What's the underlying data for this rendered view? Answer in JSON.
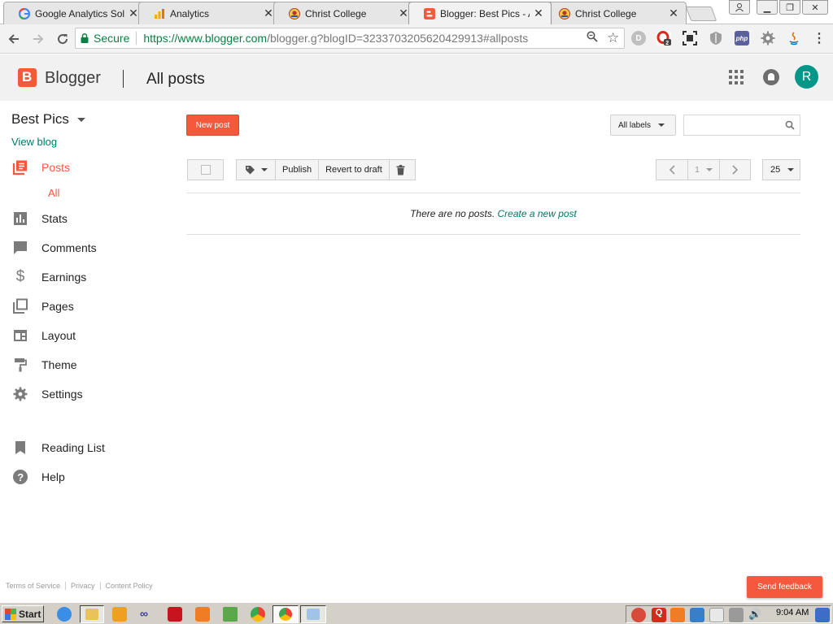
{
  "browser": {
    "tabs": [
      {
        "title": "Google Analytics Soluti",
        "icon": "google-g-icon"
      },
      {
        "title": "Analytics",
        "icon": "analytics-bars-icon"
      },
      {
        "title": "Christ College",
        "icon": "christ-college-icon"
      },
      {
        "title": "Blogger: Best Pics - All",
        "icon": "blogger-icon"
      },
      {
        "title": "Christ College",
        "icon": "christ-college-icon"
      }
    ],
    "secure_label": "Secure",
    "url_scheme_host": "https://www.blogger.com",
    "url_path": "/blogger.g?blogID=3233703205620429913#allposts",
    "ext_badge_count": "2"
  },
  "header": {
    "brand": "Blogger",
    "page_title": "All posts",
    "avatar_letter": "R"
  },
  "sidebar": {
    "blog_name": "Best Pics",
    "view_blog": "View blog",
    "items": [
      {
        "label": "Posts",
        "icon": "posts-icon"
      },
      {
        "label": "Stats",
        "icon": "stats-icon"
      },
      {
        "label": "Comments",
        "icon": "comments-icon"
      },
      {
        "label": "Earnings",
        "icon": "dollar-icon"
      },
      {
        "label": "Pages",
        "icon": "pages-icon"
      },
      {
        "label": "Layout",
        "icon": "layout-icon"
      },
      {
        "label": "Theme",
        "icon": "paint-roller-icon"
      },
      {
        "label": "Settings",
        "icon": "gear-icon"
      },
      {
        "label": "Reading List",
        "icon": "bookmark-icon"
      },
      {
        "label": "Help",
        "icon": "help-icon"
      }
    ],
    "sub_item": "All",
    "footer_links": [
      "Terms of Service",
      "Privacy",
      "Content Policy"
    ]
  },
  "main": {
    "new_post": "New post",
    "labels_filter": "All labels",
    "search_placeholder": "",
    "publish": "Publish",
    "revert_to_draft": "Revert to draft",
    "page_number": "1",
    "per_page": "25",
    "empty_text": "There are no posts.",
    "create_link": "Create a new post",
    "send_feedback": "Send feedback"
  },
  "taskbar": {
    "start_label": "Start",
    "clock": "9:04 AM"
  },
  "colors": {
    "blogger_orange": "#f5593d",
    "link_teal": "#00786a",
    "avatar_teal": "#009688",
    "secure_green": "#0b8043"
  }
}
